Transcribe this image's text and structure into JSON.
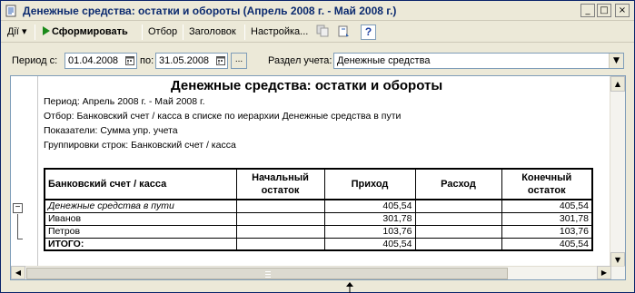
{
  "window": {
    "title": "Денежные средства: остатки и обороты (Апрель 2008 г. - Май 2008 г.)",
    "controls": [
      "_",
      "□",
      "×"
    ]
  },
  "toolbar": {
    "actions_label": "Дії",
    "actions_arrow": "▾",
    "run_label": "Сформировать",
    "filter_label": "Отбор",
    "header_label": "Заголовок",
    "settings_label": "Настройка...",
    "help_label": "?"
  },
  "params": {
    "period_from_label": "Период с:",
    "period_from_value": "01.04.2008",
    "period_to_label": "по:",
    "period_to_value": "31.05.2008",
    "period_btn": "...",
    "section_label": "Раздел учета:",
    "section_value": "Денежные средства"
  },
  "report": {
    "title": "Денежные средства: остатки и обороты",
    "info_lines": [
      "Период: Апрель 2008 г. - Май 2008 г.",
      "Отбор: Банковский счет / касса в списке по иерархии Денежные средства в пути",
      "Показатели:  Сумма упр. учета",
      "Группировки строк: Банковский счет / касса"
    ],
    "columns": [
      "Банковский счет / касса",
      "Начальный остаток",
      "Приход",
      "Расход",
      "Конечный остаток"
    ],
    "rows": [
      {
        "name": "Денежные средства в пути",
        "start": "",
        "in": "405,54",
        "out": "",
        "end": "405,54",
        "style": "group"
      },
      {
        "name": "Иванов",
        "start": "",
        "in": "301,78",
        "out": "",
        "end": "301,78",
        "style": "item"
      },
      {
        "name": "Петров",
        "start": "",
        "in": "103,76",
        "out": "",
        "end": "103,76",
        "style": "item"
      },
      {
        "name": "ИТОГО:",
        "start": "",
        "in": "405,54",
        "out": "",
        "end": "405,54",
        "style": "total"
      }
    ],
    "group_toggle": "−"
  },
  "colors": {
    "title_text": "#0b2a6f",
    "window_bg": "#ECE9D8",
    "field_border": "#7f9db9",
    "run_icon": "#1a8a1a"
  }
}
